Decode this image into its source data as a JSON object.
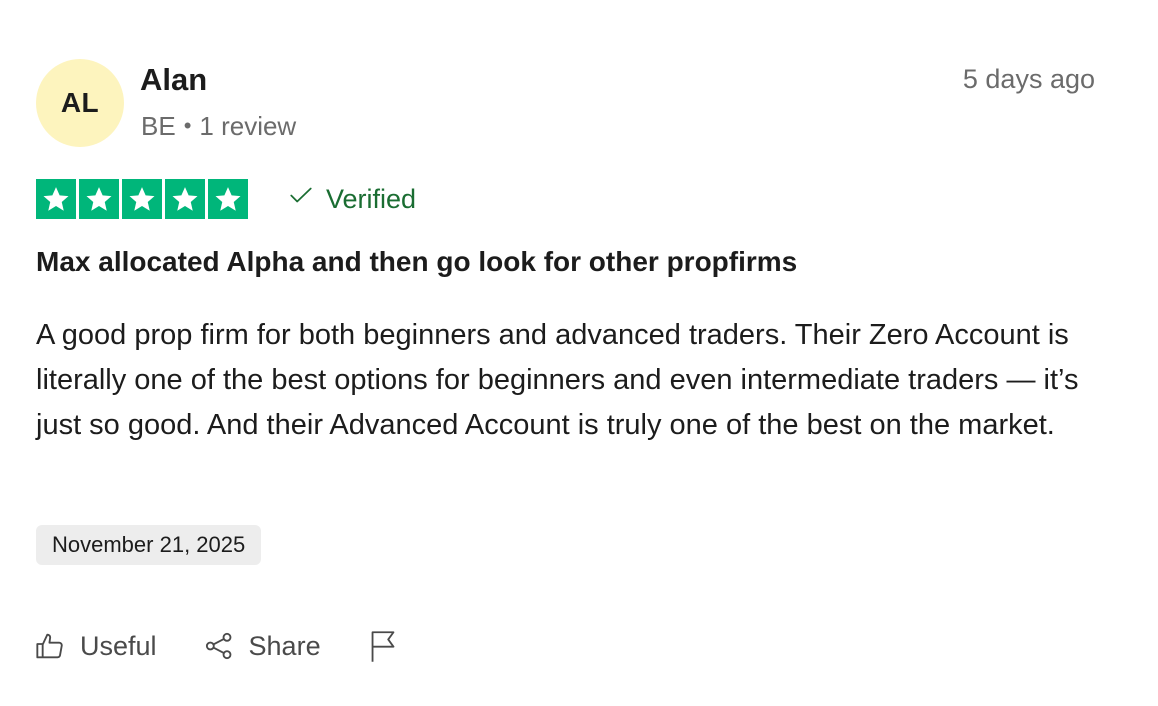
{
  "reviewer": {
    "initials": "AL",
    "name": "Alan",
    "country": "BE",
    "review_count": "1 review",
    "separator": "•"
  },
  "review": {
    "relative_date": "5 days ago",
    "rating": 5,
    "verified_label": "Verified",
    "title": "Max allocated Alpha and then go look for other propfirms",
    "body": "A good prop firm for both beginners and advanced traders. Their Zero Account is literally one of the best options for beginners and even intermediate traders — it’s just so good. And their Advanced Account is truly one of the best on the market.",
    "experience_date": "November 21, 2025"
  },
  "actions": {
    "useful_label": "Useful",
    "share_label": "Share"
  },
  "colors": {
    "star_green": "#00b67a",
    "verified_green": "#1a6d32",
    "avatar_bg": "#fdf4be"
  },
  "icons": [
    "star-icon",
    "check-icon",
    "thumbs-up-icon",
    "share-icon",
    "flag-icon"
  ]
}
